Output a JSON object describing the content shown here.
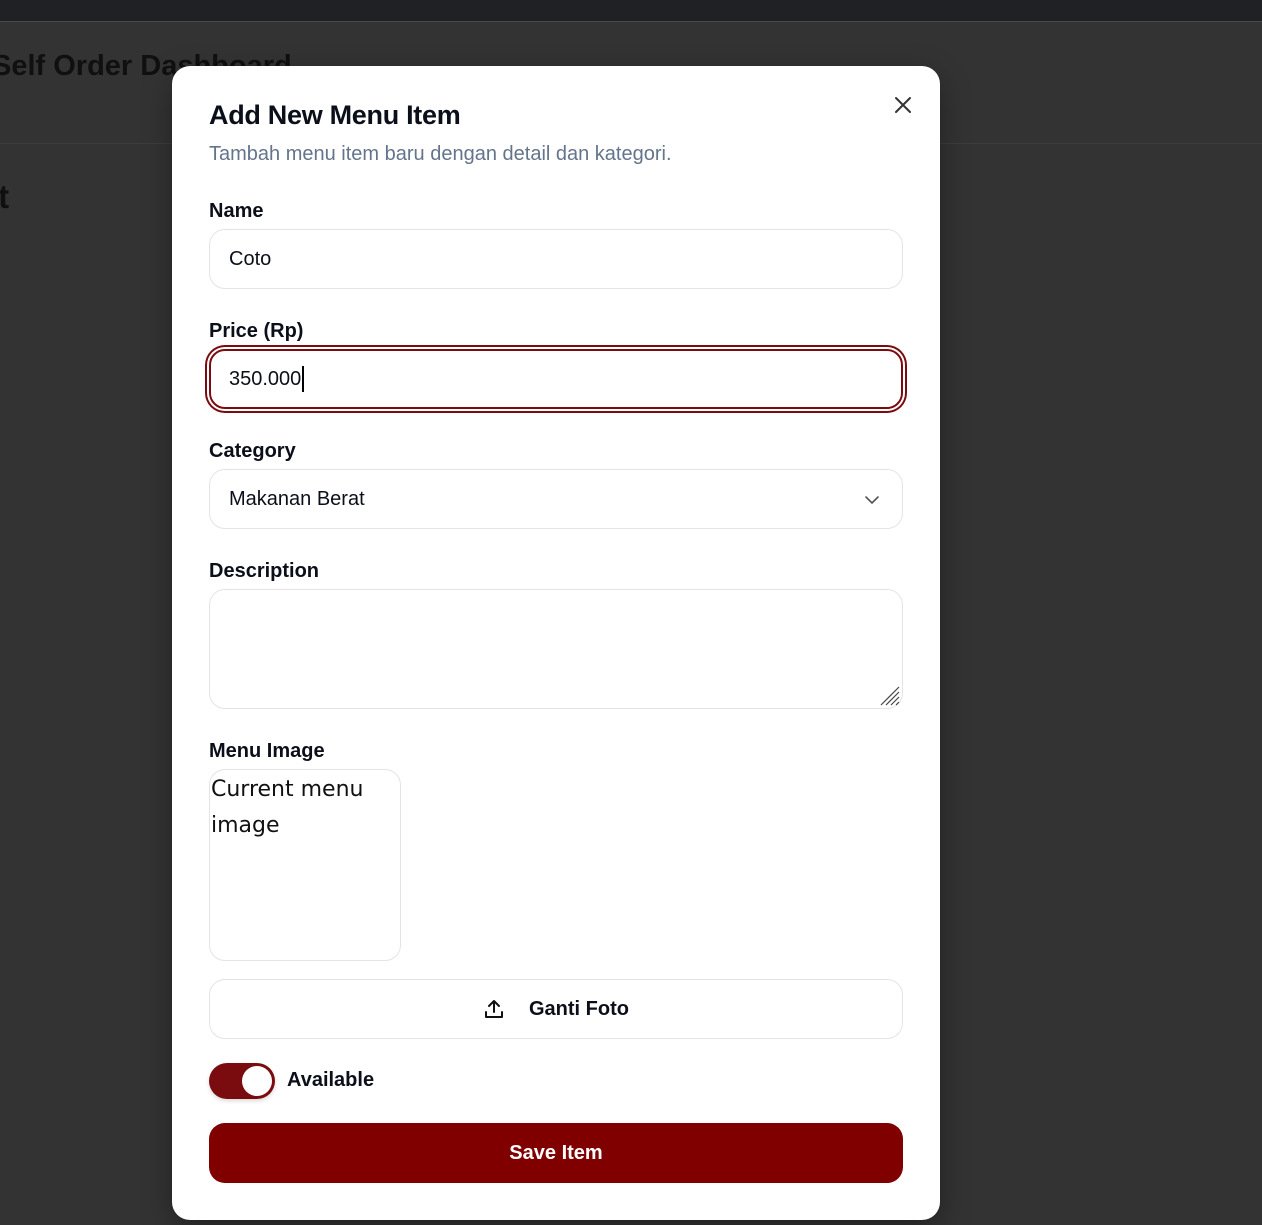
{
  "background": {
    "dashboard_title": "Self Order Dashboard",
    "page_heading": "nt"
  },
  "dialog": {
    "title": "Add New Menu Item",
    "description": "Tambah menu item baru dengan detail dan kategori.",
    "close_icon": "close-icon"
  },
  "form": {
    "name": {
      "label": "Name",
      "value": "Coto"
    },
    "price": {
      "label": "Price (Rp)",
      "value": "350.000",
      "focused": true
    },
    "category": {
      "label": "Category",
      "selected": "Makanan Berat",
      "icon": "chevron-down-icon"
    },
    "description": {
      "label": "Description",
      "value": ""
    },
    "image": {
      "label": "Menu Image",
      "alt_text": "Current menu image"
    },
    "upload": {
      "label": "Ganti Foto",
      "icon": "upload-icon"
    },
    "available": {
      "label": "Available",
      "checked": true
    },
    "submit": {
      "label": "Save Item"
    }
  },
  "colors": {
    "accent": "#800000",
    "focus_ring": "#7a0c10",
    "overlay_bg": "#333333",
    "muted_text": "#64748b"
  }
}
